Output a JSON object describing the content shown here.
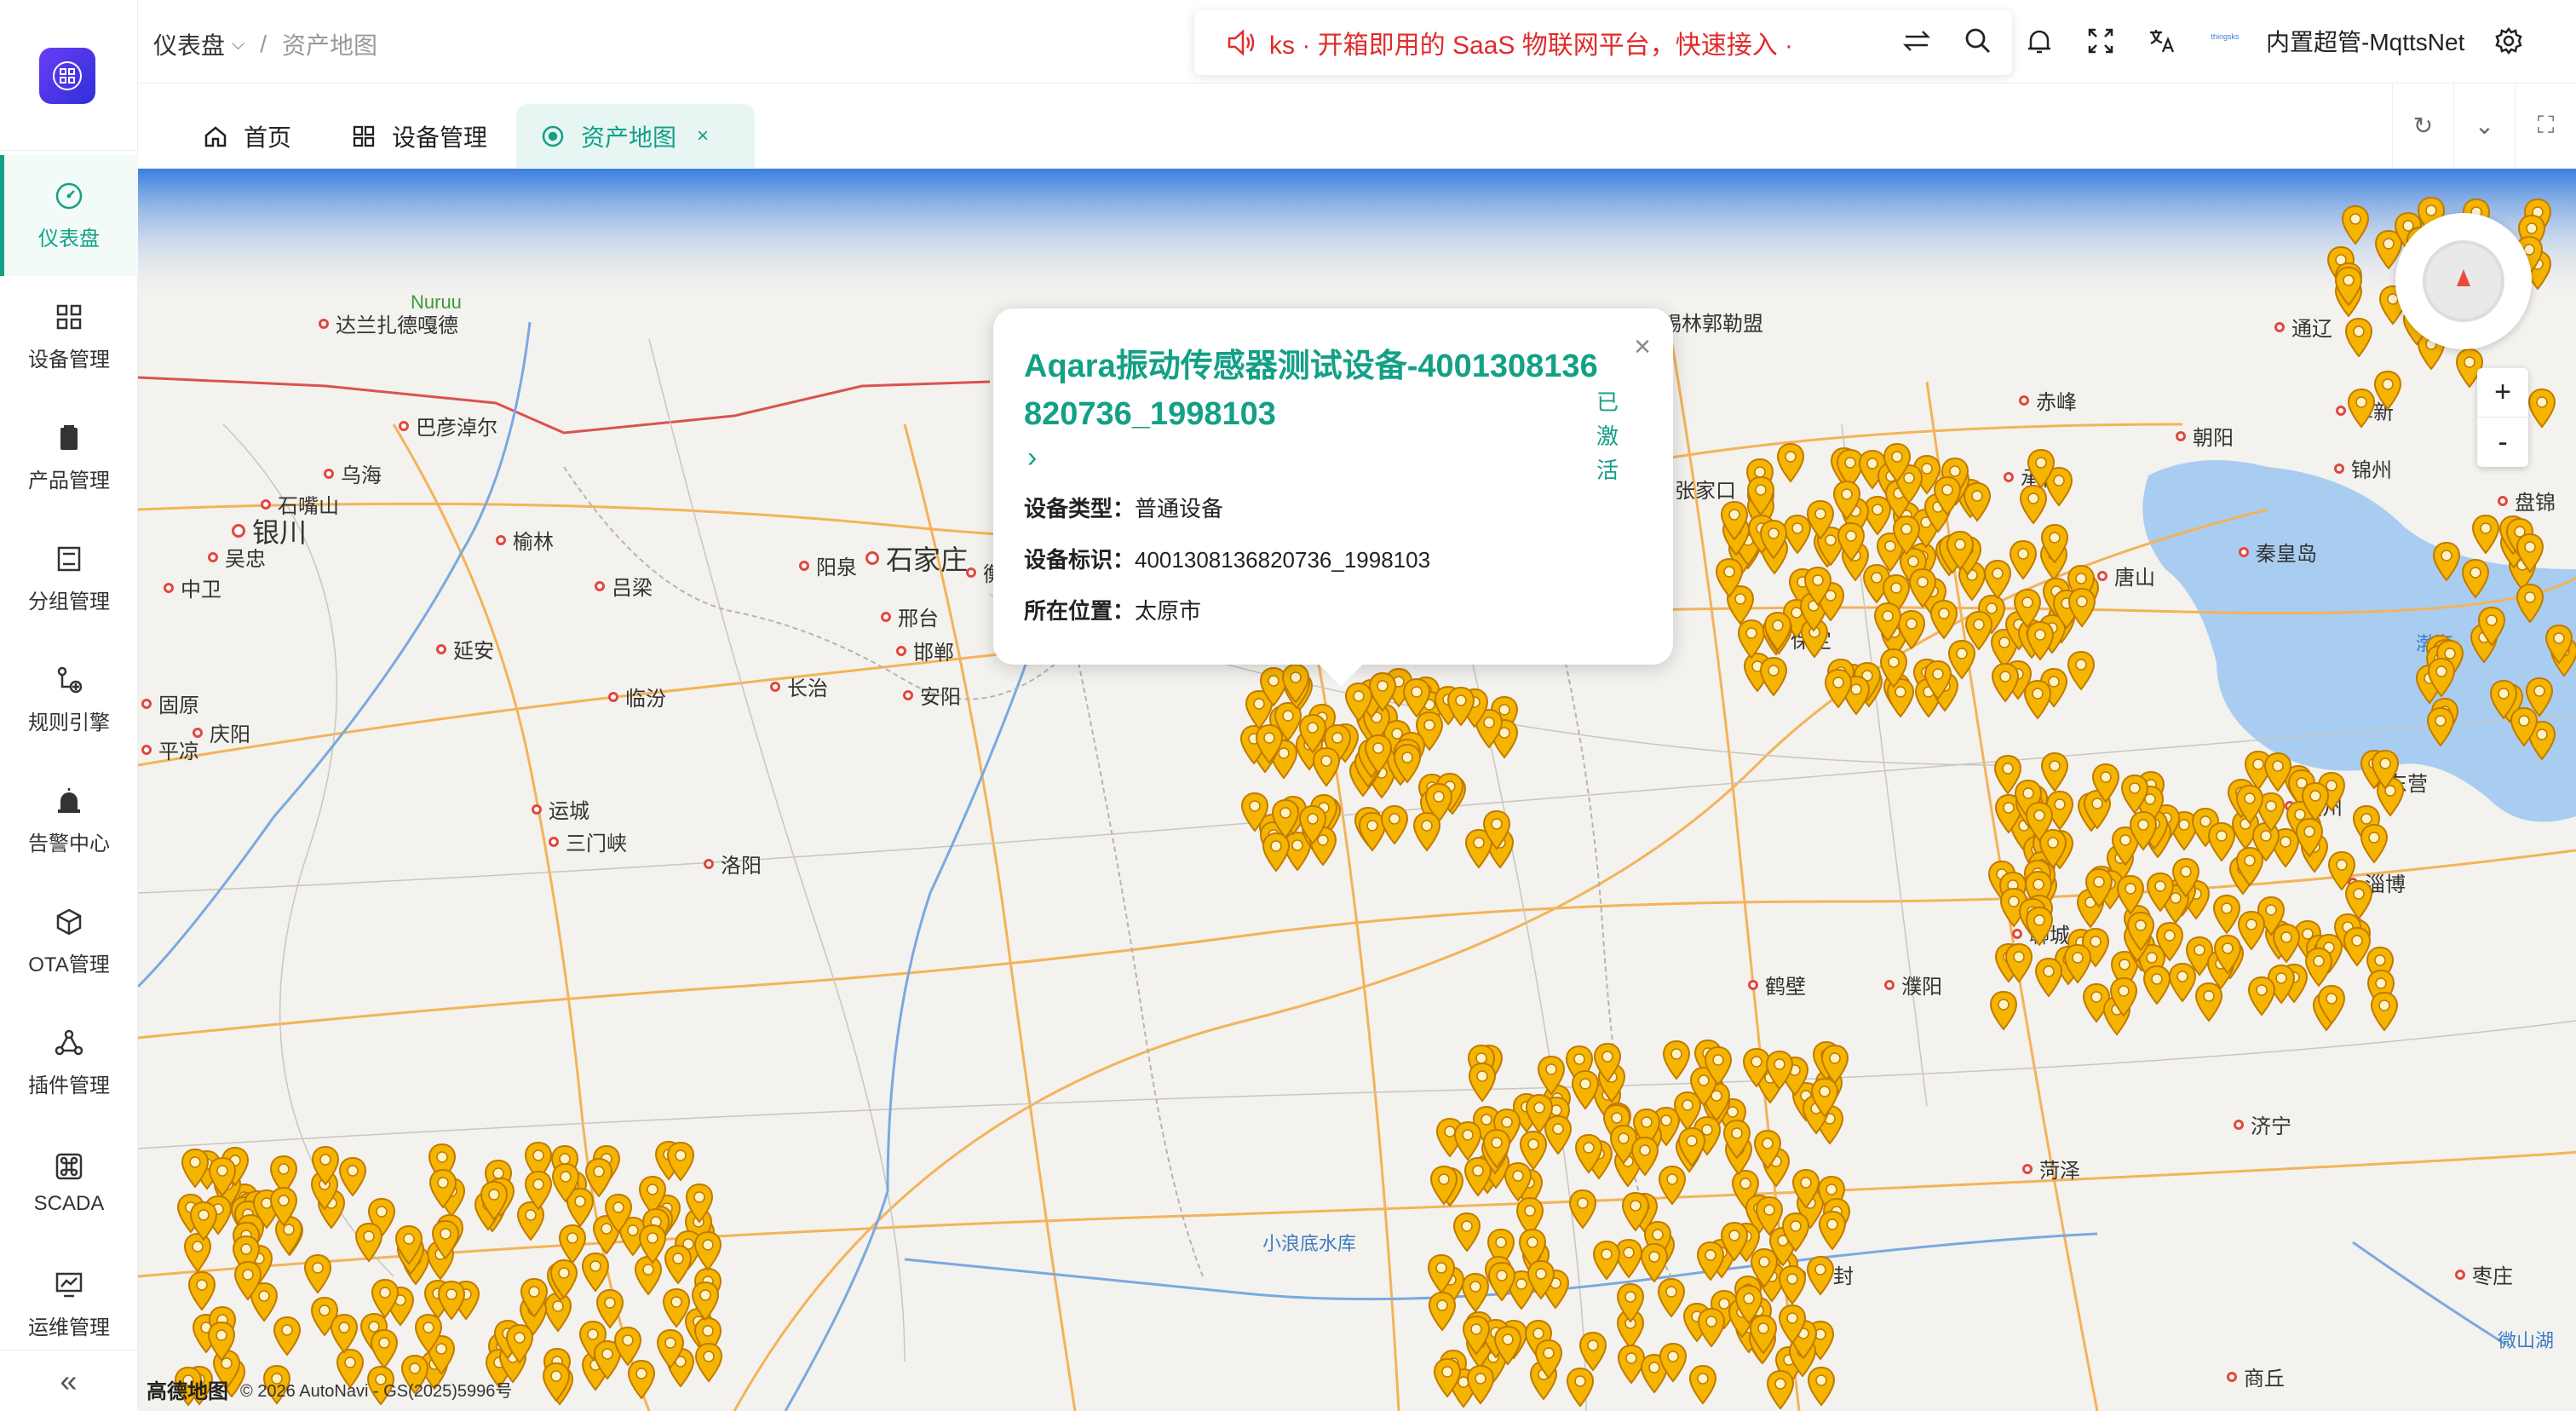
{
  "sidebar": {
    "items": [
      {
        "label": "仪表盘",
        "icon": "dashboard-icon",
        "active": true
      },
      {
        "label": "设备管理",
        "icon": "grid-icon"
      },
      {
        "label": "产品管理",
        "icon": "product-icon"
      },
      {
        "label": "分组管理",
        "icon": "group-icon"
      },
      {
        "label": "规则引擎",
        "icon": "rule-icon"
      },
      {
        "label": "告警中心",
        "icon": "alarm-icon"
      },
      {
        "label": "OTA管理",
        "icon": "box-icon"
      },
      {
        "label": "插件管理",
        "icon": "plugin-icon"
      },
      {
        "label": "SCADA",
        "icon": "scada-icon"
      },
      {
        "label": "运维管理",
        "icon": "monitor-icon"
      }
    ],
    "collapse_label": "«"
  },
  "header": {
    "breadcrumb": [
      "仪表盘",
      "资产地图"
    ],
    "notice": "ks · 开箱即用的 SaaS 物联网平台，快速接入 ·",
    "username": "内置超管-MqttsNet",
    "user_logo_text": "thingsks"
  },
  "tabs": [
    {
      "label": "首页",
      "icon": "home-icon"
    },
    {
      "label": "设备管理",
      "icon": "grid-icon"
    },
    {
      "label": "资产地图",
      "icon": "map-icon",
      "active": true,
      "close": "×"
    }
  ],
  "popup": {
    "title": "Aqara振动传感器测试设备-4001308136820736_1998103",
    "status": "已激活",
    "arrow": "›",
    "close": "×",
    "rows": [
      {
        "label": "设备类型：",
        "value": "普通设备"
      },
      {
        "label": "设备标识：",
        "value": "4001308136820736_1998103"
      },
      {
        "label": "所在位置：",
        "value": "太原市"
      }
    ]
  },
  "map": {
    "cities": [
      {
        "name": "达兰扎德嘎德"
      },
      {
        "name": "巴彦淖尔"
      },
      {
        "name": "乌海"
      },
      {
        "name": "石嘴山"
      },
      {
        "name": "银川",
        "big": true
      },
      {
        "name": "吴忠"
      },
      {
        "name": "中卫"
      },
      {
        "name": "榆林"
      },
      {
        "name": "吕梁"
      },
      {
        "name": "延安"
      },
      {
        "name": "固原"
      },
      {
        "name": "庆阳"
      },
      {
        "name": "平凉"
      },
      {
        "name": "临汾"
      },
      {
        "name": "运城"
      },
      {
        "name": "三门峡"
      },
      {
        "name": "洛阳"
      },
      {
        "name": "长治"
      },
      {
        "name": "阳泉"
      },
      {
        "name": "石家庄",
        "big": true
      },
      {
        "name": "衡水"
      },
      {
        "name": "邢台"
      },
      {
        "name": "邯郸"
      },
      {
        "name": "安阳"
      },
      {
        "name": "鹤壁"
      },
      {
        "name": "濮阳"
      },
      {
        "name": "聊城"
      },
      {
        "name": "保定"
      },
      {
        "name": "唐山"
      },
      {
        "name": "承德"
      },
      {
        "name": "赤峰"
      },
      {
        "name": "朝阳"
      },
      {
        "name": "通辽"
      },
      {
        "name": "锦州"
      },
      {
        "name": "秦皇岛"
      },
      {
        "name": "东营"
      },
      {
        "name": "淄博"
      },
      {
        "name": "济宁"
      },
      {
        "name": "菏泽"
      },
      {
        "name": "枣庄"
      },
      {
        "name": "商丘"
      },
      {
        "name": "开封"
      },
      {
        "name": "张家口"
      },
      {
        "name": "锡林郭勒盟"
      },
      {
        "name": "阜新"
      },
      {
        "name": "滨州"
      },
      {
        "name": "盘锦"
      },
      {
        "name": "商丘"
      }
    ],
    "water": [
      "渤海",
      "小浪底水库",
      "微山湖"
    ],
    "border_labels": [
      "Nuruu"
    ],
    "zoom_in": "+",
    "zoom_out": "-",
    "attribution_brand": "高德地图",
    "attribution": "© 2026 AutoNavi - GS(2025)5996号"
  },
  "colors": {
    "accent": "#13a086",
    "notice": "#e02b2b",
    "pin": "#f5b400"
  }
}
